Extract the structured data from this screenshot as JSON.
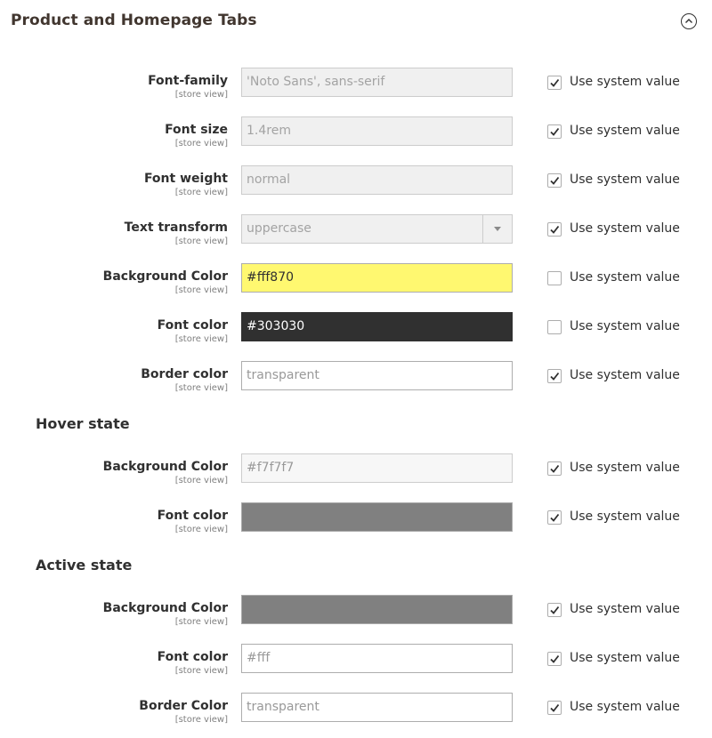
{
  "section": {
    "title": "Product and Homepage Tabs",
    "collapse_icon": "chevron-up-circle-icon"
  },
  "scope_label": "[store view]",
  "use_system_label": "Use system value",
  "rows": [
    {
      "label": "Font-family",
      "value": "'Noto Sans', sans-serif",
      "system": true
    },
    {
      "label": "Font size",
      "value": "1.4rem",
      "system": true
    },
    {
      "label": "Font weight",
      "value": "normal",
      "system": true
    },
    {
      "label": "Text transform",
      "value": "uppercase",
      "system": true,
      "type": "select"
    },
    {
      "label": "Background Color",
      "value": "#fff870",
      "system": false,
      "color": "#fff870"
    },
    {
      "label": "Font color",
      "value": "#303030",
      "system": false,
      "color": "#303030"
    },
    {
      "label": "Border color",
      "value": "transparent",
      "system": true
    }
  ],
  "hover": {
    "title": "Hover state",
    "rows": [
      {
        "label": "Background Color",
        "value": "#f7f7f7",
        "system": true,
        "color": "#f7f7f7"
      },
      {
        "label": "Font color",
        "value": "",
        "system": true,
        "color": "#808080"
      }
    ]
  },
  "active": {
    "title": "Active state",
    "rows": [
      {
        "label": "Background Color",
        "value": "",
        "system": true,
        "color": "#808080"
      },
      {
        "label": "Font color",
        "value": "#fff",
        "system": true
      },
      {
        "label": "Border Color",
        "value": "transparent",
        "system": true
      }
    ]
  }
}
